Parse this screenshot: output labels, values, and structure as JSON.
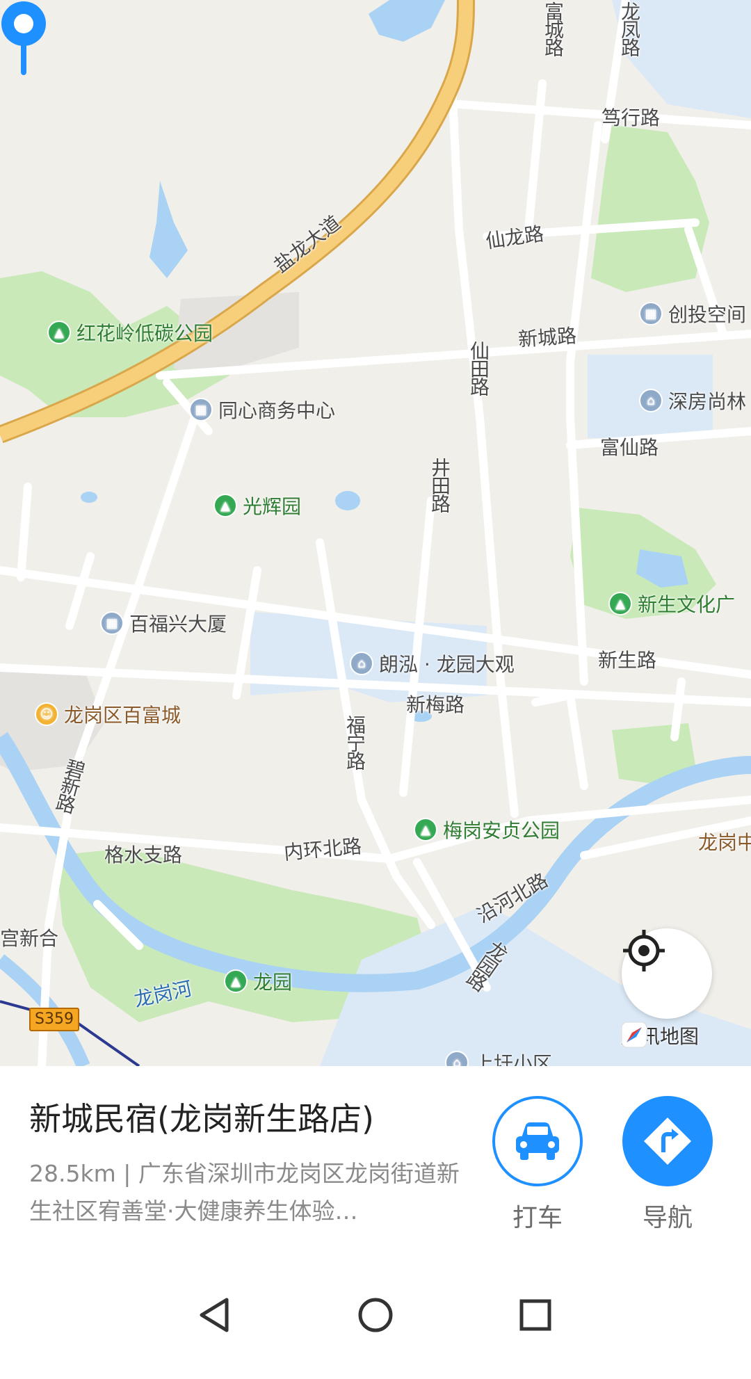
{
  "map": {
    "roads": {
      "yanlong_ave": "盐龙大道",
      "fucheng_rd": "富城路",
      "longfeng_rd": "龙凤路",
      "duxing_rd": "笃行路",
      "xianlong_rd": "仙龙路",
      "xincheng_rd": "新城路",
      "xiantian_rd": "仙田路",
      "fuxian_rd": "富仙路",
      "jingtian_rd": "井田路",
      "xinsheng_rd": "新生路",
      "xinmei_rd": "新梅路",
      "funing_rd": "福宁路",
      "bixin_rd": "碧新路",
      "geshui_rd": "格水支路",
      "neihuan_rd": "内环北路",
      "yanhe_rd": "沿河北路",
      "longyuan_rd": "龙园路",
      "longgang_river": "龙岗河",
      "s359": "S359"
    },
    "pois": {
      "honghualing": "红花岭低碳公园",
      "tongxin": "同心商务中心",
      "guanghui": "光辉园",
      "baifuxing": "百福兴大厦",
      "langhong": "朗泓 · 龙园大观",
      "baifucheng": "龙岗区百富城",
      "meigang": "梅岗安贞公园",
      "longyuan": "龙园",
      "chuangtou": "创投空间",
      "shenfang": "深房尚林",
      "xinsheng_culture": "新生文化广",
      "longgang_center": "龙岗中",
      "guanxinhe": "宫新合",
      "shangwu": "上圩小区"
    },
    "brand": "腾讯地图"
  },
  "sheet": {
    "name": "新城民宿(龙岗新生路店)",
    "distance": "28.5km",
    "separator": "|",
    "address": "广东省深圳市龙岗区龙岗街道新生社区宥善堂·大健康养生体验…",
    "taxi_label": "打车",
    "nav_label": "导航"
  },
  "colors": {
    "accent": "#1e90ff",
    "park": "#c9e9b9",
    "water": "#a9d2f5",
    "highway": "#f7cf7a"
  }
}
